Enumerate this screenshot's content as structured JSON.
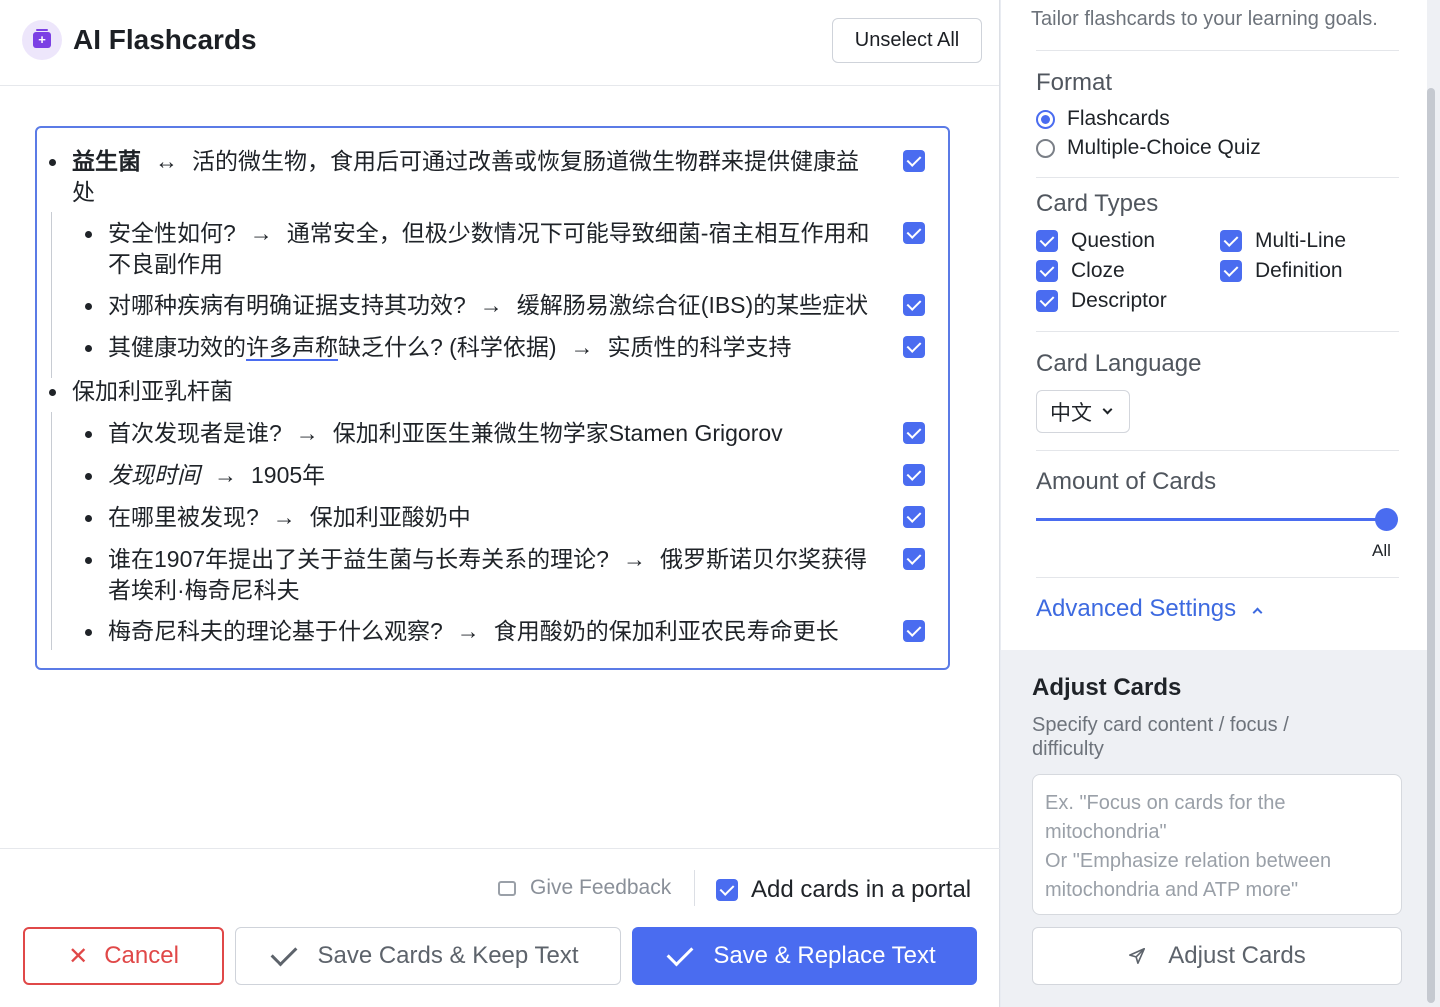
{
  "header": {
    "title": "AI Flashcards",
    "unselect_label": "Unselect All",
    "app_icon": "flashcards-icon"
  },
  "cards": {
    "groups": [
      {
        "front": "益生菌",
        "relation": "↔",
        "back": "活的微生物，食用后可通过改善或恢复肠道微生物群来提供健康益处",
        "children": [
          {
            "front": "安全性如何?",
            "back": "通常安全，但极少数情况下可能导致细菌-宿主相互作用和不良副作用"
          },
          {
            "front": "对哪种疾病有明确证据支持其功效?",
            "back": "缓解肠易激综合征(IBS)的某些症状"
          },
          {
            "front_a": "其健康功效的",
            "front_u": "许多声称",
            "front_b": "缺乏什么? (科学依据)",
            "back": "实质性的科学支持"
          }
        ]
      },
      {
        "front": "保加利亚乳杆菌",
        "children": [
          {
            "front": "首次发现者是谁?",
            "back": "保加利亚医生兼微生物学家Stamen Grigorov"
          },
          {
            "front": "发现时间",
            "back": "1905年"
          },
          {
            "front": "在哪里被发现?",
            "back": "保加利亚酸奶中"
          },
          {
            "front": "谁在1907年提出了关于益生菌与长寿关系的理论?",
            "back": "俄罗斯诺贝尔奖获得者埃利·梅奇尼科夫"
          },
          {
            "front": "梅奇尼科夫的理论基于什么观察?",
            "back": "食用酸奶的保加利亚农民寿命更长"
          }
        ]
      }
    ],
    "arrow": "→"
  },
  "footer": {
    "feedback_label": "Give Feedback",
    "portal_label": "Add cards in a portal",
    "cancel_label": "Cancel",
    "keep_label": "Save Cards & Keep Text",
    "replace_label": "Save & Replace Text"
  },
  "settings": {
    "tailor_text": "Tailor flashcards to your learning goals.",
    "format_title": "Format",
    "format_options": [
      "Flashcards",
      "Multiple-Choice Quiz"
    ],
    "format_selected": "Flashcards",
    "card_types_title": "Card Types",
    "card_types": [
      "Question",
      "Multi-Line",
      "Cloze",
      "Definition",
      "Descriptor"
    ],
    "language_title": "Card Language",
    "language_value": "中文",
    "amount_title": "Amount of Cards",
    "amount_value": "All",
    "advanced_label": "Advanced Settings"
  },
  "adjust": {
    "title": "Adjust Cards",
    "subtitle": "Specify card content / focus / difficulty",
    "placeholder": "Ex. \"Focus on cards for the mitochondria\"\nOr \"Emphasize relation between mitochondria and ATP more\"",
    "button_label": "Adjust Cards"
  },
  "colors": {
    "accent": "#4a6cf0",
    "danger": "#e04848",
    "link": "#3d6ae0"
  }
}
